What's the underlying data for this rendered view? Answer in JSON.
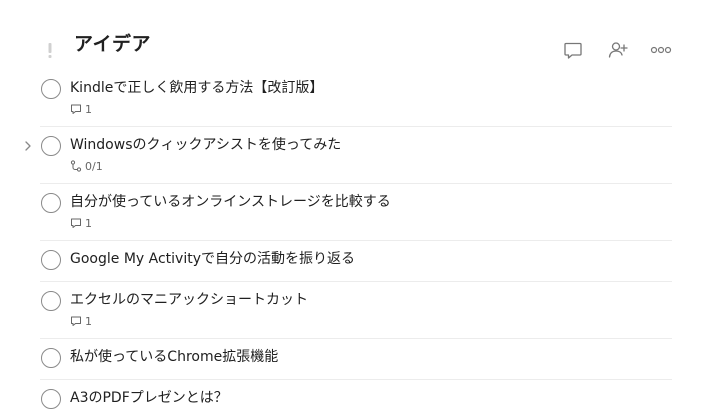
{
  "project": {
    "title": "アイデア"
  },
  "header_actions": {
    "comment_icon": "comment-icon",
    "share_icon": "add-person-icon",
    "more_icon": "more-icon"
  },
  "tasks": [
    {
      "text": "Kindleで正しく飲用する方法【改訂版】",
      "meta_icon": "comment-icon",
      "meta_text": "1"
    },
    {
      "text": "Windowsのクィックアシストを使ってみた",
      "meta_icon": "subtask-icon",
      "meta_text": "0/1",
      "has_subtasks": true
    },
    {
      "text": "自分が使っているオンラインストレージを比較する",
      "meta_icon": "comment-icon",
      "meta_text": "1"
    },
    {
      "text": "Google My Activityで自分の活動を振り返る"
    },
    {
      "text": "エクセルのマニアックショートカット",
      "meta_icon": "comment-icon",
      "meta_text": "1"
    },
    {
      "text": "私が使っているChrome拡張機能"
    },
    {
      "text": "A3のPDFプレゼンとは？"
    }
  ],
  "colors": {
    "text": "#202020",
    "muted": "#666666",
    "checkbox_border": "#8a8a8a",
    "divider": "#ececec"
  }
}
